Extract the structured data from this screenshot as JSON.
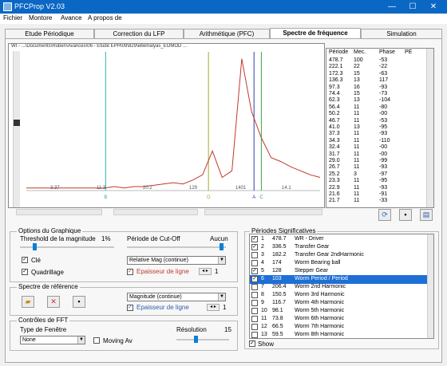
{
  "window": {
    "title": "PFCProp V2.03",
    "minimize": "—",
    "maximize": "☐",
    "close": "✕"
  },
  "menu": [
    "Fichier",
    "Montore",
    "Avance",
    "A propos de"
  ],
  "tabs": [
    "Etude Périodique",
    "Correction du LFP",
    "Arithmétique (PFC)",
    "Spectre de fréquence",
    "Simulation"
  ],
  "active_tab": 3,
  "plot": {
    "path_text": "WI - ...\\Documents\\Ruben\\Avances\\06 - Etude EPH\\09\\829\\eltemalyas_EOMOD ...",
    "colors": {
      "curve": "#c0392b",
      "cursor_teal": "#2bb3b3",
      "cursor_olive": "#a6a832",
      "cursor_blue": "#2f3fa6",
      "cursor_green": "#3fa34d"
    }
  },
  "chart_data": {
    "type": "line",
    "title": "",
    "xlabel": "",
    "ylabel": "",
    "x_tick_labels": [
      "3.37",
      "11.3",
      "20.2",
      "129",
      "1401",
      "14.1"
    ],
    "cursor_labels": [
      "B",
      "D",
      "A",
      "C"
    ],
    "series": [
      {
        "values": [
          2,
          2,
          2,
          2,
          2,
          2,
          2,
          2,
          2,
          3,
          2,
          3,
          3,
          4,
          5,
          6,
          5,
          8,
          12,
          30,
          10,
          15,
          100,
          60,
          40,
          25,
          22,
          18,
          15,
          12,
          10
        ]
      }
    ]
  },
  "table": {
    "headers": [
      "Période",
      "Mec.",
      "Phase",
      "PE"
    ],
    "rows": [
      [
        "478.7",
        "100",
        "-53",
        ""
      ],
      [
        "222.1",
        "22",
        "-22",
        ""
      ],
      [
        "172.3",
        "15",
        "-63",
        ""
      ],
      [
        "136.3",
        "13",
        "117",
        ""
      ],
      [
        "97.3",
        "16",
        "-93",
        ""
      ],
      [
        "74.4",
        "15",
        "-73",
        ""
      ],
      [
        "62.3",
        "13",
        "-104",
        ""
      ],
      [
        "56.4",
        "11",
        "-80",
        ""
      ],
      [
        "50.2",
        "11",
        "-00",
        ""
      ],
      [
        "46.7",
        "11",
        "-53",
        ""
      ],
      [
        "41.0",
        "13",
        "-95",
        ""
      ],
      [
        "37.3",
        "11",
        "-93",
        ""
      ],
      [
        "34.3",
        "11",
        "-110",
        ""
      ],
      [
        "32.4",
        "11",
        "-00",
        ""
      ],
      [
        "31.7",
        "11",
        "-00",
        ""
      ],
      [
        "29.0",
        "11",
        "-99",
        ""
      ],
      [
        "26.7",
        "11",
        "-93",
        ""
      ],
      [
        "25.2",
        "3",
        "-97",
        ""
      ],
      [
        "23.3",
        "11",
        "-95",
        ""
      ],
      [
        "22.9",
        "11",
        "-93",
        ""
      ],
      [
        "21.6",
        "11",
        "-91",
        ""
      ],
      [
        "21.7",
        "11",
        "-33",
        ""
      ]
    ]
  },
  "options_group": {
    "title": "Options du Graphique",
    "threshold_label": "Threshold de la magnitude",
    "threshold_unit": "1%",
    "cutoff_label": "Période de Cut-Off",
    "cutoff_value": "Aucun",
    "cle_label": "Clé",
    "cle_checked": true,
    "grid_label": "Quadrillage",
    "grid_checked": true,
    "mode_value": "Relative Mag (continue)",
    "thickness_label": "Epaisseur de ligne",
    "thickness_value": "1"
  },
  "reference_group": {
    "title": "Spectre de référence",
    "mode_value": "Magnitude (continue)",
    "thickness_label": "Epaisseur de ligne",
    "thickness_value": "1"
  },
  "controls_group": {
    "title": "Contrôles de FFT",
    "window_label": "Type de Fenêtre",
    "window_value": "None",
    "moving_avg_label": "Moving Av",
    "resolution_label": "Résolution",
    "resolution_value": "15"
  },
  "periods_group": {
    "title": "Périodes Significatives",
    "items": [
      {
        "n": "1",
        "period": "478.7",
        "desc": "WR - Driver",
        "checked": true,
        "selected": false
      },
      {
        "n": "2",
        "period": "336.5",
        "desc": "Transfer Gear",
        "checked": true,
        "selected": false
      },
      {
        "n": "3",
        "period": "182.2",
        "desc": "Transfer Gear 2ndHarmonic",
        "checked": false,
        "selected": false
      },
      {
        "n": "4",
        "period": "174",
        "desc": "Worm Bearing ball",
        "checked": false,
        "selected": false
      },
      {
        "n": "5",
        "period": "128",
        "desc": "Stepper Gear",
        "checked": true,
        "selected": false
      },
      {
        "n": "6",
        "period": "103",
        "desc": "Worm Period / Period",
        "checked": true,
        "selected": true
      },
      {
        "n": "7",
        "period": "206.4",
        "desc": "Worm 2nd Harmonic",
        "checked": false,
        "selected": false
      },
      {
        "n": "8",
        "period": "150.5",
        "desc": "Worm 3rd Harmonic",
        "checked": false,
        "selected": false
      },
      {
        "n": "9",
        "period": "116.7",
        "desc": "Worm 4th Harmonic",
        "checked": false,
        "selected": false
      },
      {
        "n": "10",
        "period": "98.1",
        "desc": "Worm 5th Harmonic",
        "checked": false,
        "selected": false
      },
      {
        "n": "11",
        "period": "73.8",
        "desc": "Worm 6th Harmonic",
        "checked": false,
        "selected": false
      },
      {
        "n": "12",
        "period": "66.5",
        "desc": "Worm 7th Harmonic",
        "checked": false,
        "selected": false
      },
      {
        "n": "13",
        "period": "59.5",
        "desc": "Worm 8th Harmonic",
        "checked": false,
        "selected": false
      }
    ],
    "show_label": "Show",
    "show_checked": true
  },
  "icons": {
    "open": "open-folder-icon",
    "delete": "delete-x-icon",
    "save": "save-disk-icon"
  }
}
